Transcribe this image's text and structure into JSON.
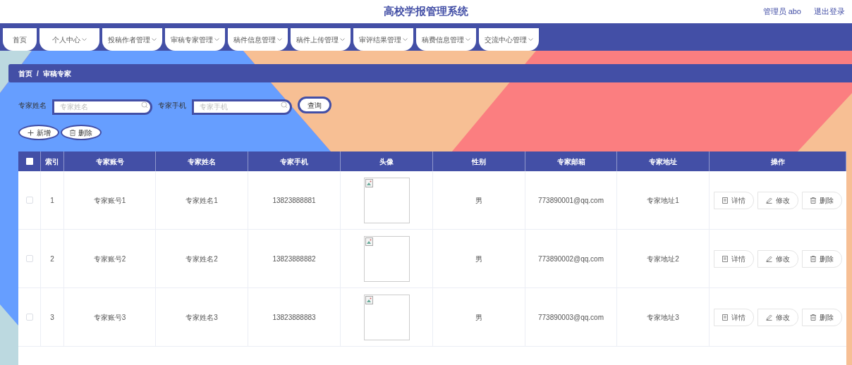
{
  "header": {
    "title": "高校学报管理系统",
    "user": "管理员 abo",
    "logout": "退出登录"
  },
  "nav": [
    {
      "label": "首页",
      "dropdown": false
    },
    {
      "label": "个人中心",
      "dropdown": true
    },
    {
      "label": "投稿作者管理",
      "dropdown": true
    },
    {
      "label": "审稿专家管理",
      "dropdown": true
    },
    {
      "label": "稿件信息管理",
      "dropdown": true
    },
    {
      "label": "稿件上传管理",
      "dropdown": true
    },
    {
      "label": "审评结果管理",
      "dropdown": true
    },
    {
      "label": "稿费信息管理",
      "dropdown": true
    },
    {
      "label": "交流中心管理",
      "dropdown": true
    }
  ],
  "breadcrumb": {
    "items": [
      "首页",
      "审稿专家"
    ],
    "separator": "/"
  },
  "search": {
    "fields": [
      {
        "label": "专家姓名",
        "placeholder": "专家姓名"
      },
      {
        "label": "专家手机",
        "placeholder": "专家手机"
      }
    ],
    "button": "查询"
  },
  "actions": [
    {
      "kind": "add",
      "label": "新增"
    },
    {
      "kind": "delete",
      "label": "删除"
    }
  ],
  "table": {
    "select_all_checked": false,
    "columns": [
      "索引",
      "专家账号",
      "专家姓名",
      "专家手机",
      "头像",
      "性别",
      "专家邮箱",
      "专家地址",
      "操作"
    ],
    "rows": [
      {
        "checked": false,
        "index": "1",
        "account": "专家账号1",
        "name": "专家姓名1",
        "phone": "13823888881",
        "gender": "男",
        "email": "773890001@qq.com",
        "address": "专家地址1",
        "actions": [
          {
            "kind": "detail",
            "label": "详情"
          },
          {
            "kind": "edit",
            "label": "修改"
          },
          {
            "kind": "delete",
            "label": "删除"
          }
        ]
      },
      {
        "checked": false,
        "index": "2",
        "account": "专家账号2",
        "name": "专家姓名2",
        "phone": "13823888882",
        "gender": "男",
        "email": "773890002@qq.com",
        "address": "专家地址2",
        "actions": [
          {
            "kind": "detail",
            "label": "详情"
          },
          {
            "kind": "edit",
            "label": "修改"
          },
          {
            "kind": "delete",
            "label": "删除"
          }
        ]
      },
      {
        "checked": false,
        "index": "3",
        "account": "专家账号3",
        "name": "专家姓名3",
        "phone": "13823888883",
        "gender": "男",
        "email": "773890003@qq.com",
        "address": "专家地址3",
        "actions": [
          {
            "kind": "detail",
            "label": "详情"
          },
          {
            "kind": "edit",
            "label": "修改"
          },
          {
            "kind": "delete",
            "label": "删除"
          }
        ]
      }
    ]
  }
}
